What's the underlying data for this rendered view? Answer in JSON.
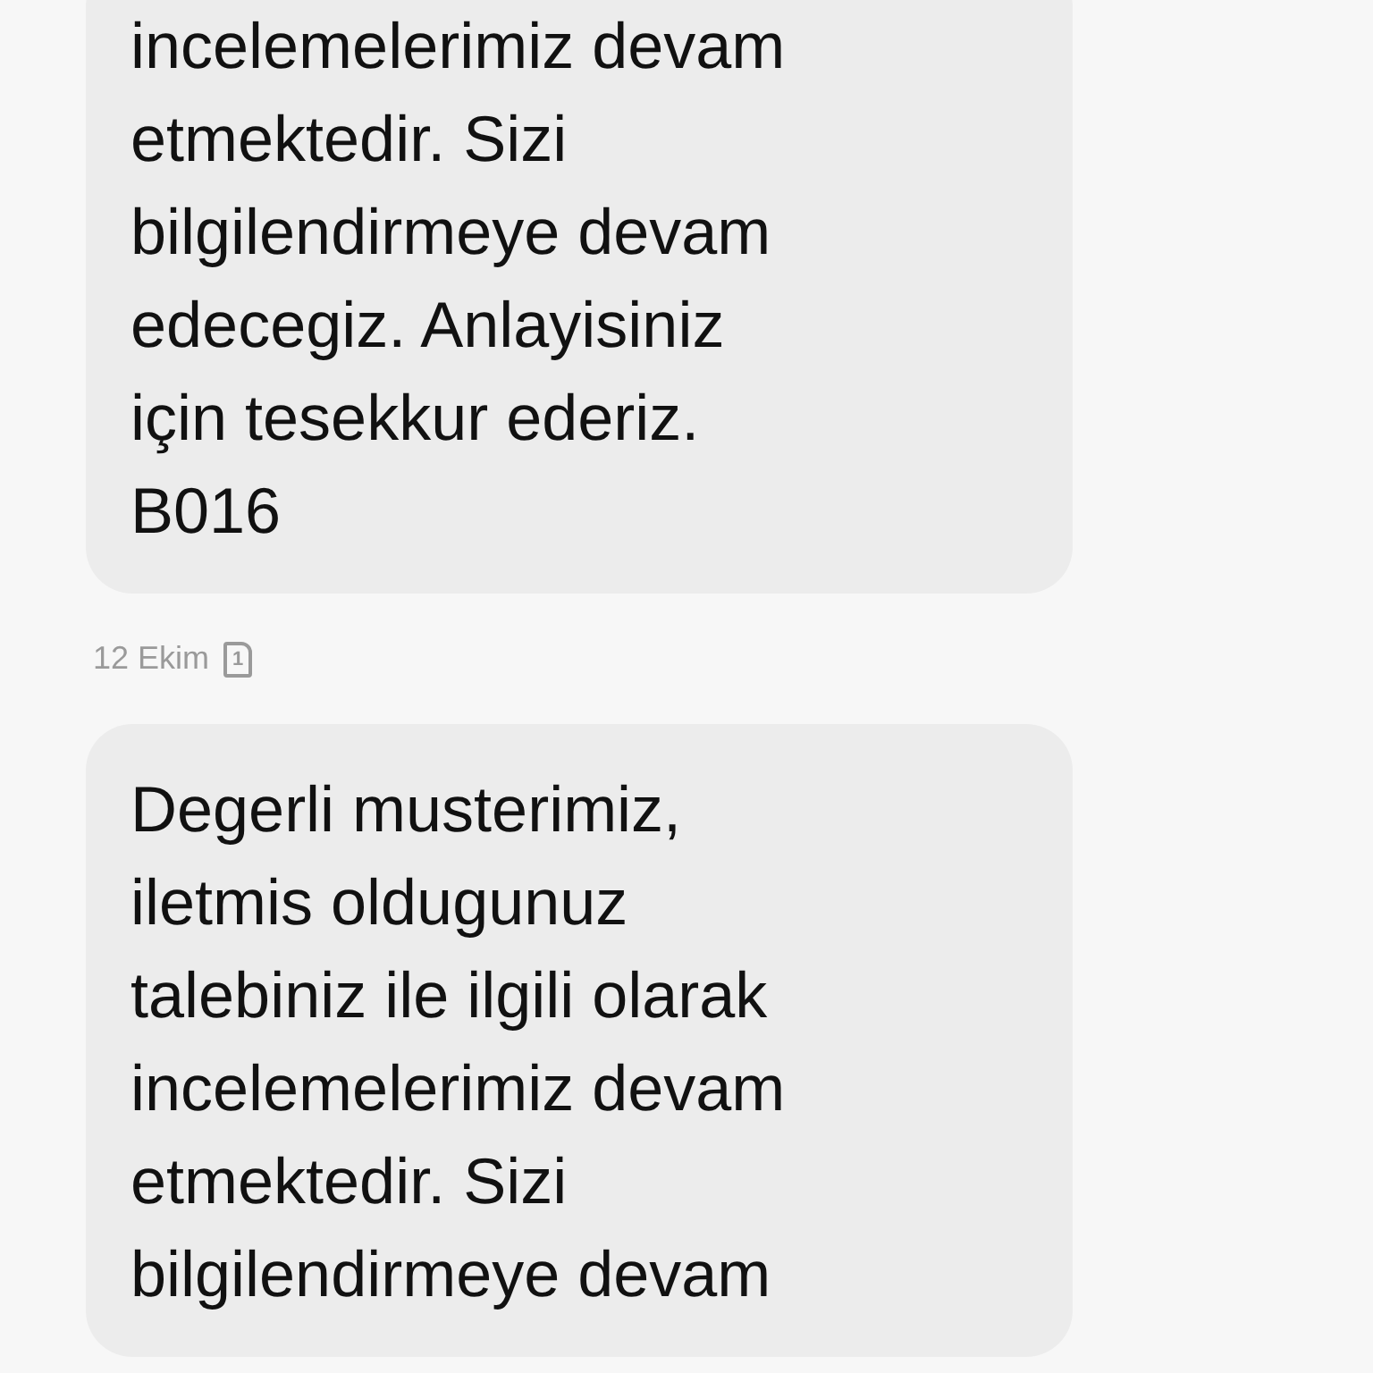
{
  "messages": [
    {
      "text": "incelemelerimiz devam\netmektedir. Sizi\nbilgilendirmeye devam\nedecegiz. Anlayisiniz\niçin tesekkur ederiz.\nB016",
      "date": "12 Ekim",
      "sim": "1"
    },
    {
      "text": "Degerli musterimiz,\niletmis oldugunuz\ntalebiniz ile ilgili olarak\nincelemelerimiz devam\netmektedir. Sizi\nbilgilendirmeye devam"
    }
  ]
}
